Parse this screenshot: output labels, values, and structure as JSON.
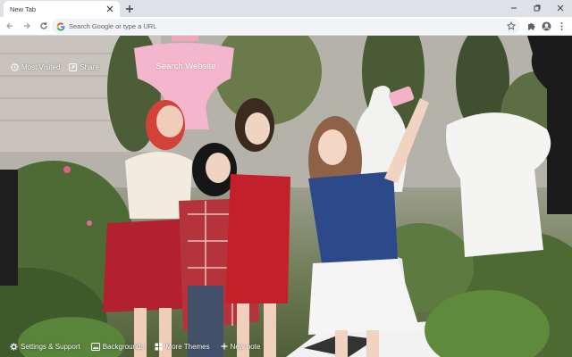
{
  "tab": {
    "title": "New Tab",
    "close_icon": "close-icon"
  },
  "toolbar": {
    "omnibox_placeholder": "Search Google or type a URL",
    "icons": [
      "back-arrow-icon",
      "forward-arrow-icon",
      "reload-icon",
      "google-g-icon",
      "star-icon",
      "extensions-icon",
      "profile-icon",
      "kebab-menu-icon"
    ]
  },
  "newtab": {
    "most_visited": "Most Visited",
    "share": "Share",
    "search_placeholder": "Search Website"
  },
  "bottom_bar": {
    "settings": "Settings & Support",
    "backgrounds": "Backgrounds",
    "more_themes": "More Themes",
    "new_note": "New note"
  },
  "colors": {
    "tabstrip": "#dee1e6",
    "toolbar": "#ffffff",
    "omnibox": "#f1f3f4",
    "pink_accent": "#f3b6cc",
    "red_outfit": "#b3202e",
    "blue_top": "#2c4a8a"
  }
}
